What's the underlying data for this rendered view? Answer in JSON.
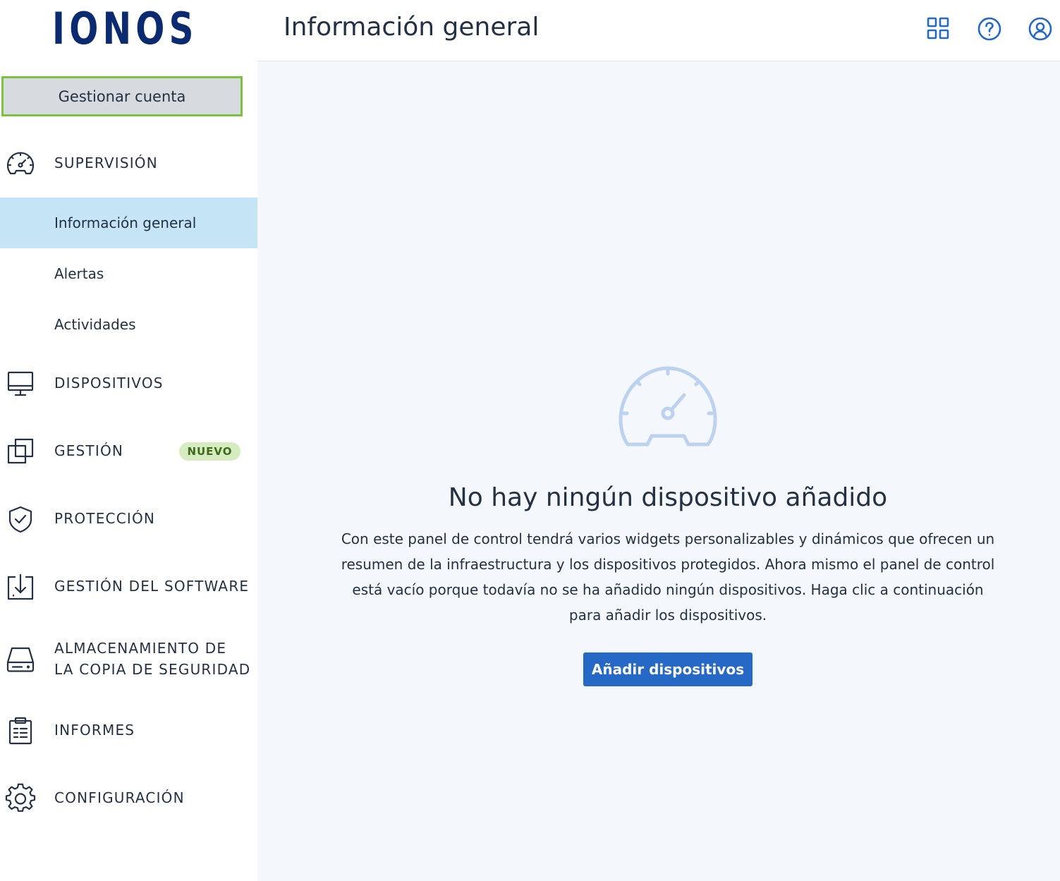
{
  "brand": {
    "logo_text": "IONOS"
  },
  "sidebar": {
    "manage_account": "Gestionar cuenta",
    "monitoring": {
      "label": "SUPERVISIÓN",
      "icon": "speedometer-icon",
      "items": [
        {
          "label": "Información general",
          "active": true
        },
        {
          "label": "Alertas",
          "active": false
        },
        {
          "label": "Actividades",
          "active": false
        }
      ]
    },
    "devices": {
      "label": "DISPOSITIVOS",
      "icon": "monitor-icon"
    },
    "management": {
      "label": "GESTIÓN",
      "icon": "copy-squares-icon",
      "badge": "NUEVO"
    },
    "protection": {
      "label": "PROTECCIÓN",
      "icon": "shield-check-icon"
    },
    "software": {
      "label": "GESTIÓN DEL SOFTWARE",
      "icon": "download-tray-icon"
    },
    "backup": {
      "label_line1": "ALMACENAMIENTO DE",
      "label_line2": "LA COPIA DE SEGURIDAD",
      "icon": "hard-drive-icon"
    },
    "reports": {
      "label": "INFORMES",
      "icon": "clipboard-icon"
    },
    "settings": {
      "label": "CONFIGURACIÓN",
      "icon": "gear-icon"
    }
  },
  "header": {
    "title": "Información general",
    "icons": [
      "apps-grid-icon",
      "help-icon",
      "user-account-icon"
    ]
  },
  "main": {
    "empty_icon": "speedometer-icon",
    "empty_title": "No hay ningún dispositivo añadido",
    "empty_description": "Con este panel de control tendrá varios widgets personalizables y dinámicos que ofrecen un resumen de la infraestructura y los dispositivos protegidos. Ahora mismo el panel de control está vacío porque todavía no se ha añadido ningún dispositivos. Haga clic a continuación para añadir los dispositivos.",
    "add_button": "Añadir dispositivos"
  },
  "colors": {
    "brand": "#0b2a6f",
    "accent": "#2668c5",
    "active_nav": "#c5e5f7",
    "badge_bg": "#d7ebc0",
    "highlight_border": "#7cc242"
  }
}
